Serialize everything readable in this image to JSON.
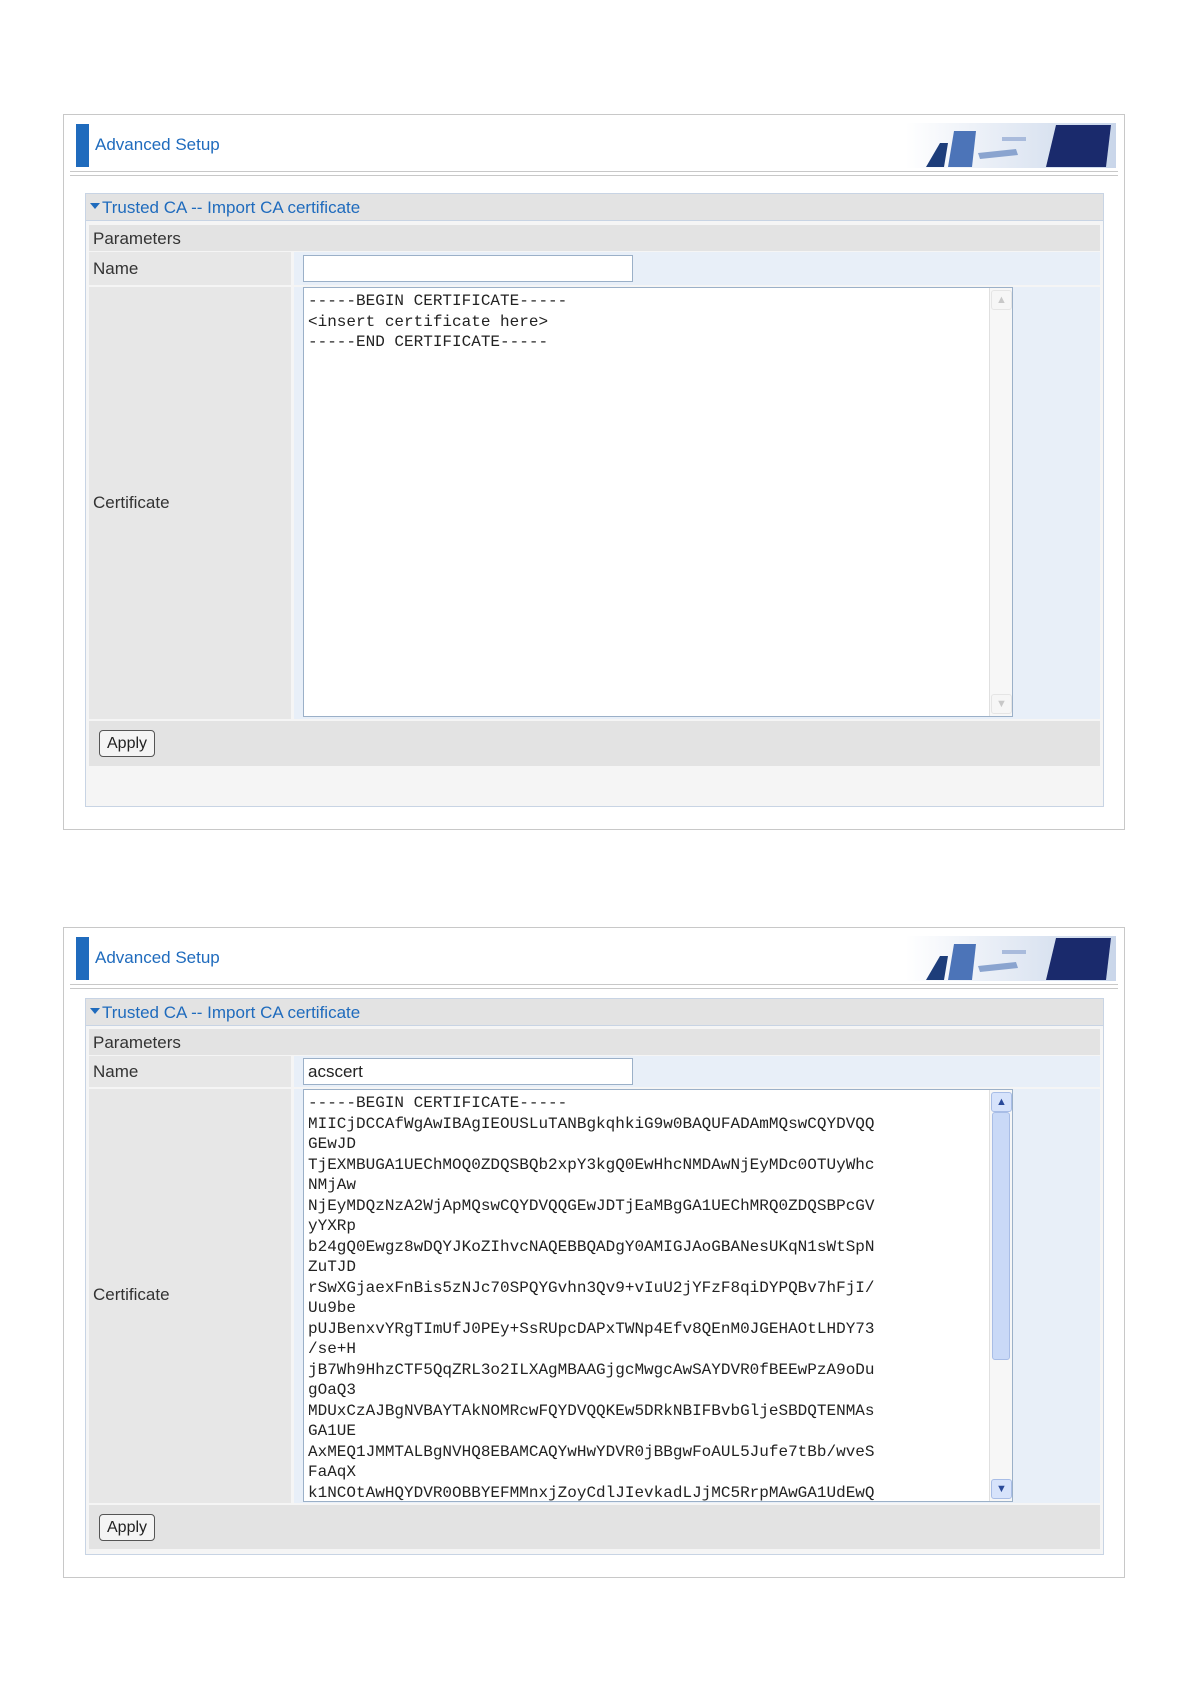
{
  "panels": [
    {
      "header_title": "Advanced Setup",
      "section_title": "Trusted CA -- Import CA certificate",
      "params_label": "Parameters",
      "name_label": "Name",
      "name_value": "",
      "certificate_label": "Certificate",
      "certificate_text": "-----BEGIN CERTIFICATE-----\n<insert certificate here>\n-----END CERTIFICATE-----",
      "apply_label": "Apply"
    },
    {
      "header_title": "Advanced Setup",
      "section_title": "Trusted CA -- Import CA certificate",
      "params_label": "Parameters",
      "name_label": "Name",
      "name_value": "acscert",
      "certificate_label": "Certificate",
      "certificate_text": "-----BEGIN CERTIFICATE-----\nMIICjDCCAfWgAwIBAgIEOUSLuTANBgkqhkiG9w0BAQUFADAmMQswCQYDVQQ\nGEwJD\nTjEXMBUGA1UEChMOQ0ZDQSBQb2xpY3kgQ0EwHhcNMDAwNjEyMDc0OTUyWhc\nNMjAw\nNjEyMDQzNzA2WjApMQswCQYDVQQGEwJDTjEaMBgGA1UEChMRQ0ZDQSBPcGV\nyYXRp\nb24gQ0Ewgz8wDQYJKoZIhvcNAQEBBQADgY0AMIGJAoGBANesUKqN1sWtSpN\nZuTJD\nrSwXGjaexFnBis5zNJc70SPQYGvhn3Qv9+vIuU2jYFzF8qiDYPQBv7hFjI/\nUu9be\npUJBenxvYRgTImUfJ0PEy+SsRUpcDAPxTWNp4Efv8QEnM0JGEHAOtLHDY73\n/se+H\njB7Wh9HhzCTF5QqZRL3o2ILXAgMBAAGjgcMwgcAwSAYDVR0fBEEwPzA9oDu\ngOaQ3\nMDUxCzAJBgNVBAYTAkNOMRcwFQYDVQQKEw5DRkNBIFBvbGljeSBDQTENMAs\nGA1UE\nAxMEQ1JMMTALBgNVHQ8EBAMCAQYwHwYDVR0jBBgwFoAUL5Jufe7tBb/wveS\nFaAqX\nk1NCOtAwHQYDVR0OBBYEFMMnxjZoyCdlJIevkadLJjMC5RrpMAwGA1UdEwQ",
      "apply_label": "Apply"
    }
  ]
}
